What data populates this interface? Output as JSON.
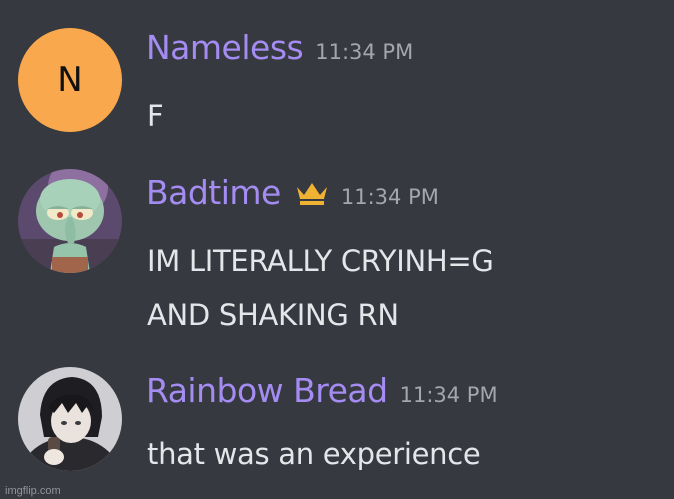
{
  "messages": [
    {
      "username": "Nameless",
      "timestamp": "11:34 PM",
      "avatar_letter": "N",
      "lines": [
        "F"
      ]
    },
    {
      "username": "Badtime",
      "timestamp": "11:34 PM",
      "badge": "crown-icon",
      "lines": [
        "IM LITERALLY CRYINH=G",
        "AND SHAKING RN"
      ]
    },
    {
      "username": "Rainbow Bread",
      "timestamp": "11:34 PM",
      "lines": [
        "that was an experience"
      ]
    }
  ],
  "colors": {
    "background": "#36393f",
    "username": "#a48cf2",
    "timestamp": "#a3a6aa",
    "text": "#e4e6e9",
    "avatar_orange": "#f9a84e",
    "crown": "#f0b232"
  },
  "watermark": "imgflip.com"
}
